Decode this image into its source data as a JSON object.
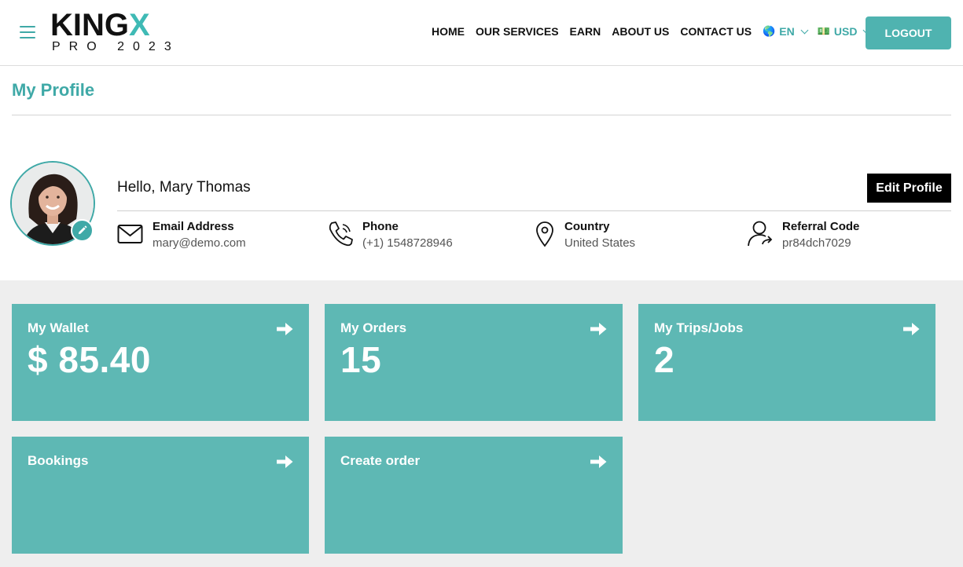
{
  "header": {
    "logo_main": "KING",
    "logo_x": "X",
    "logo_sub": "PRO 2023",
    "nav": [
      {
        "label": "HOME"
      },
      {
        "label": "OUR SERVICES"
      },
      {
        "label": "EARN"
      },
      {
        "label": "ABOUT US"
      },
      {
        "label": "CONTACT US"
      }
    ],
    "language": {
      "flag": "🌎",
      "label": "EN"
    },
    "currency": {
      "flag": "💵",
      "label": "USD"
    },
    "logout_label": "LOGOUT",
    "accent_color": "#3fa9a7"
  },
  "page": {
    "title": "My Profile"
  },
  "profile": {
    "greeting": "Hello, Mary Thomas",
    "edit_label": "Edit Profile",
    "email": {
      "label": "Email Address",
      "value": "mary@demo.com",
      "icon": "envelope-icon"
    },
    "phone": {
      "label": "Phone",
      "value": "(+1) 1548728946",
      "icon": "phone-icon"
    },
    "country": {
      "label": "Country",
      "value": "United States",
      "icon": "map-pin-icon"
    },
    "referral": {
      "label": "Referral Code",
      "value": "pr84dch7029",
      "icon": "user-share-icon"
    }
  },
  "dashboard": {
    "card_color": "#5eb8b4",
    "cards": [
      {
        "title": "My Wallet",
        "value": "$ 85.40"
      },
      {
        "title": "My Orders",
        "value": "15"
      },
      {
        "title": "My Trips/Jobs",
        "value": "2"
      },
      {
        "title": "Bookings",
        "value": ""
      },
      {
        "title": "Create order",
        "value": ""
      }
    ]
  }
}
